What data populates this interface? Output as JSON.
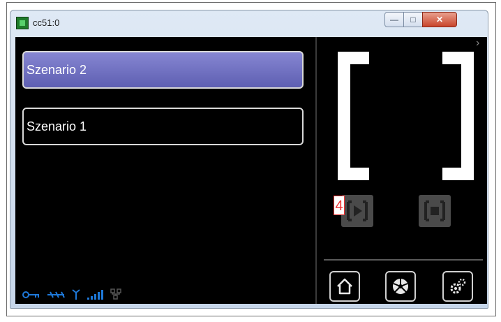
{
  "window": {
    "title": "cc51:0"
  },
  "scenarios": [
    {
      "label": "Szenario 2",
      "selected": true
    },
    {
      "label": "Szenario 1",
      "selected": false
    }
  ],
  "badge": "4",
  "icons": {
    "app": "app-icon",
    "minimize": "minimize-icon",
    "maximize": "maximize-icon",
    "close": "close-icon",
    "expand": "chevron-right-icon",
    "play": "play-icon",
    "stop": "stop-icon",
    "home": "home-icon",
    "fan": "fan-icon",
    "settings": "gear-icon",
    "status": [
      "key-icon",
      "dmx-icon",
      "antenna-icon",
      "signal-bars-icon",
      "network-icon"
    ]
  },
  "colors": {
    "selected": "#6e6ec4",
    "status": "#1e78d8"
  }
}
